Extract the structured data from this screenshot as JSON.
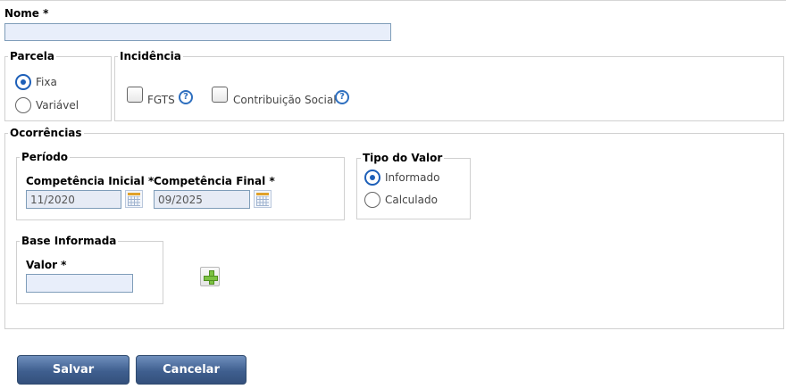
{
  "nome": {
    "label": "Nome *",
    "value": "",
    "placeholder": ""
  },
  "parcela": {
    "legend": "Parcela",
    "options": [
      {
        "label": "Fixa",
        "checked": true
      },
      {
        "label": "Variável",
        "checked": false
      }
    ]
  },
  "incidencia": {
    "legend": "Incidência",
    "options": [
      {
        "label": "FGTS",
        "checked": false
      },
      {
        "label": "Contribuição Social",
        "checked": false
      }
    ],
    "help_glyph": "?"
  },
  "ocorrencias": {
    "legend": "Ocorrências",
    "periodo": {
      "legend": "Período",
      "competencia_inicial": {
        "label": "Competência Inicial *",
        "value": "11/2020"
      },
      "competencia_final": {
        "label": "Competência Final *",
        "value": "09/2025"
      }
    },
    "tipo_valor": {
      "legend": "Tipo do Valor",
      "options": [
        {
          "label": "Informado",
          "checked": true
        },
        {
          "label": "Calculado",
          "checked": false
        }
      ]
    },
    "base_informada": {
      "legend": "Base Informada",
      "valor": {
        "label": "Valor *",
        "value": ""
      }
    }
  },
  "actions": {
    "save_label": "Salvar",
    "cancel_label": "Cancelar"
  },
  "colors": {
    "accent": "#1d5fb8",
    "button": "#3f5f8f",
    "field_bg": "#e8eefa"
  }
}
